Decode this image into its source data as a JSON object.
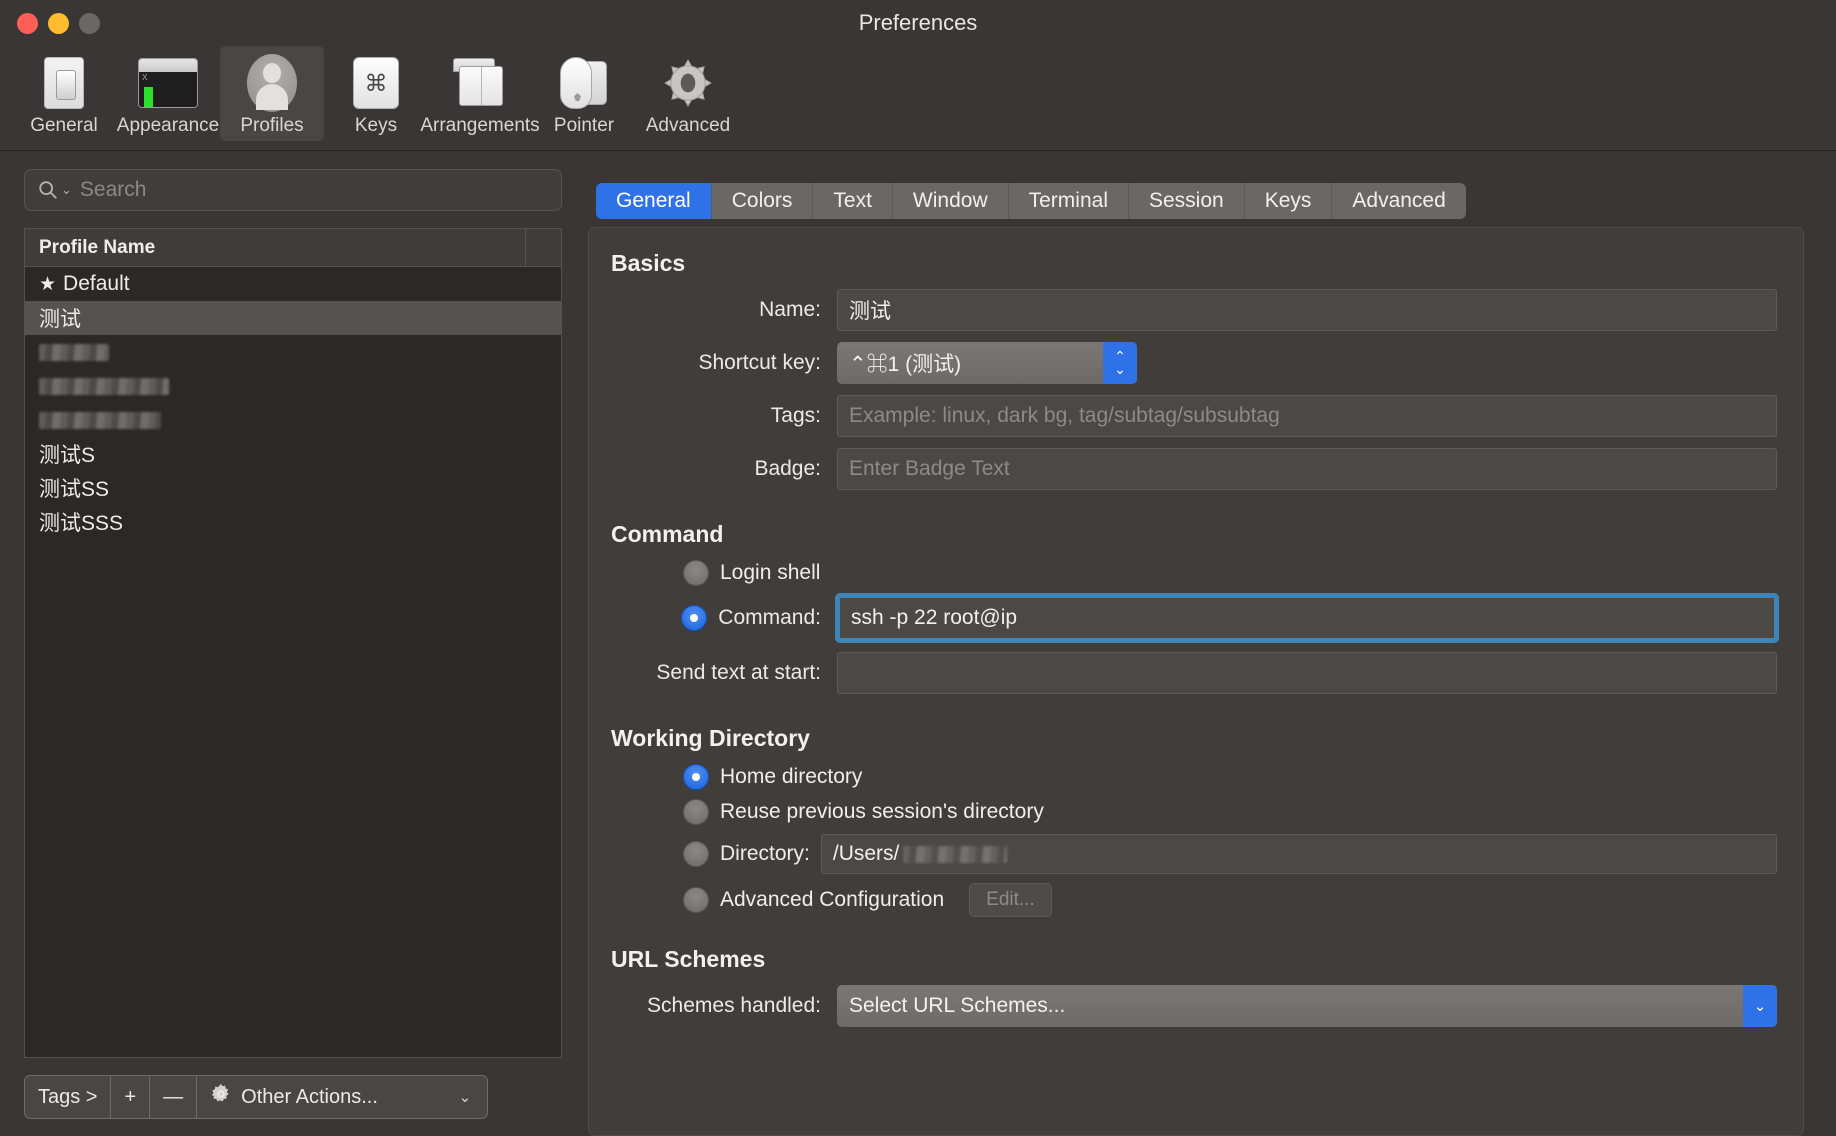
{
  "window": {
    "title": "Preferences",
    "traffic_lights": [
      "close",
      "minimize",
      "zoom"
    ]
  },
  "toolbar": {
    "items": [
      {
        "label": "General",
        "icon": "general-icon",
        "active": false
      },
      {
        "label": "Appearance",
        "icon": "appearance-icon",
        "active": false
      },
      {
        "label": "Profiles",
        "icon": "profiles-icon",
        "active": true
      },
      {
        "label": "Keys",
        "icon": "keys-icon",
        "active": false
      },
      {
        "label": "Arrangements",
        "icon": "arrangements-icon",
        "active": false
      },
      {
        "label": "Pointer",
        "icon": "pointer-icon",
        "active": false
      },
      {
        "label": "Advanced",
        "icon": "advanced-gear-icon",
        "active": false
      }
    ]
  },
  "sidebar": {
    "search": {
      "placeholder": "Search",
      "value": ""
    },
    "list": {
      "column_header": "Profile Name",
      "rows": [
        {
          "name": "Default",
          "starred": true,
          "selected": false,
          "redacted": false
        },
        {
          "name": "测试",
          "starred": false,
          "selected": true,
          "redacted": false
        },
        {
          "name": "",
          "starred": false,
          "selected": false,
          "redacted": true,
          "redact_width": 70
        },
        {
          "name": "",
          "starred": false,
          "selected": false,
          "redacted": true,
          "redact_width": 130
        },
        {
          "name": "",
          "starred": false,
          "selected": false,
          "redacted": true,
          "redact_width": 122
        },
        {
          "name": "测试S",
          "starred": false,
          "selected": false,
          "redacted": false
        },
        {
          "name": "测试SS",
          "starred": false,
          "selected": false,
          "redacted": false
        },
        {
          "name": "测试SSS",
          "starred": false,
          "selected": false,
          "redacted": false
        }
      ]
    },
    "bottom_bar": {
      "tags_label": "Tags >",
      "add_label": "+",
      "remove_label": "—",
      "other_actions_label": "Other Actions...",
      "other_actions_icon": "gear-icon",
      "chevron": "⌄"
    }
  },
  "tabs": [
    {
      "label": "General",
      "active": true
    },
    {
      "label": "Colors",
      "active": false
    },
    {
      "label": "Text",
      "active": false
    },
    {
      "label": "Window",
      "active": false
    },
    {
      "label": "Terminal",
      "active": false
    },
    {
      "label": "Session",
      "active": false
    },
    {
      "label": "Keys",
      "active": false
    },
    {
      "label": "Advanced",
      "active": false
    }
  ],
  "general": {
    "basics": {
      "title": "Basics",
      "name_label": "Name:",
      "name_value": "测试",
      "shortcut_label": "Shortcut key:",
      "shortcut_value": "⌃⌘1 (测试)",
      "tags_label": "Tags:",
      "tags_value": "",
      "tags_placeholder": "Example: linux, dark bg, tag/subtag/subsubtag",
      "badge_label": "Badge:",
      "badge_value": "",
      "badge_placeholder": "Enter Badge Text"
    },
    "command": {
      "title": "Command",
      "login_shell_label": "Login shell",
      "login_shell_selected": false,
      "command_label": "Command:",
      "command_selected": true,
      "command_value": "ssh -p 22 root@ip",
      "send_text_label": "Send text at start:",
      "send_text_value": ""
    },
    "working_directory": {
      "title": "Working Directory",
      "home_label": "Home directory",
      "home_selected": true,
      "reuse_label": "Reuse previous session's directory",
      "reuse_selected": false,
      "directory_label": "Directory:",
      "directory_selected": false,
      "directory_value": "/Users/",
      "advanced_label": "Advanced Configuration",
      "advanced_selected": false,
      "edit_button_label": "Edit..."
    },
    "url_schemes": {
      "title": "URL Schemes",
      "schemes_label": "Schemes handled:",
      "schemes_value": "Select URL Schemes...",
      "chevron": "⌄"
    }
  },
  "colors": {
    "accent_blue": "#2f72e8",
    "focus_ring": "#3f86b8",
    "window_bg": "#3a3635",
    "panel_bg": "#413d3b",
    "list_bg": "#2b2827",
    "selected_row": "#56524f"
  }
}
